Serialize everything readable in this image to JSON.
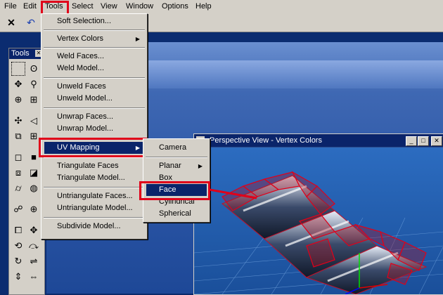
{
  "menubar": [
    "File",
    "Edit",
    "Tools",
    "Select",
    "View",
    "Window",
    "Options",
    "Help"
  ],
  "tools_palette": {
    "title": "Tools",
    "close": "✕"
  },
  "tools_menu": {
    "items": [
      {
        "label": "Soft Selection..."
      },
      {
        "label": "Vertex Colors",
        "submenu": true
      },
      {
        "label": "Weld Faces..."
      },
      {
        "label": "Weld Model..."
      },
      {
        "label": "Unweld Faces"
      },
      {
        "label": "Unweld Model..."
      },
      {
        "label": "Unwrap Faces..."
      },
      {
        "label": "Unwrap Model..."
      },
      {
        "label": "UV Mapping",
        "submenu": true,
        "selected": true
      },
      {
        "label": "Triangulate Faces"
      },
      {
        "label": "Triangulate Model..."
      },
      {
        "label": "Untriangulate Faces..."
      },
      {
        "label": "Untriangulate Model..."
      },
      {
        "label": "Subdivide Model..."
      }
    ]
  },
  "uv_submenu": {
    "items": [
      {
        "label": "Camera"
      },
      {
        "label": "Planar",
        "submenu": true
      },
      {
        "label": "Box"
      },
      {
        "label": "Face",
        "selected": true
      },
      {
        "label": "Cylindrical"
      },
      {
        "label": "Spherical"
      }
    ]
  },
  "perspective_view": {
    "title": "Perspective View - Vertex Colors",
    "min": "_",
    "max": "□",
    "close": "✕"
  },
  "colors": {
    "highlight": "#e0001a",
    "selection": "#0a246a",
    "menu_bg": "#d4d0c8"
  }
}
